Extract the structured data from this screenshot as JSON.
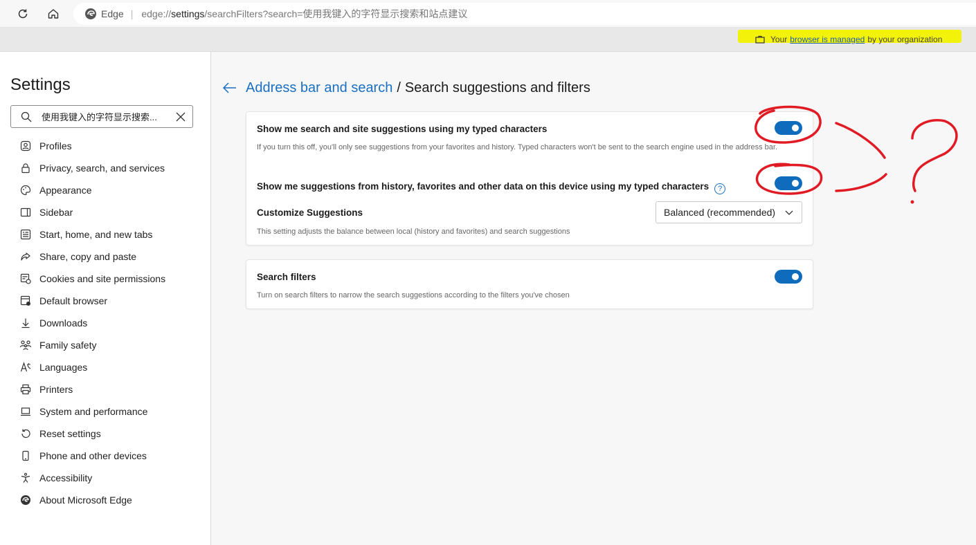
{
  "browser": {
    "brand": "Edge",
    "separator": "|",
    "url_scheme": "edge://",
    "url_host": "settings",
    "url_rest": "/searchFilters?search=使用我键入的字符显示搜索和站点建议",
    "icons": {
      "refresh": "refresh-icon",
      "home": "home-icon",
      "edge": "edge-logo-icon"
    }
  },
  "managed": {
    "prefix": "Your",
    "link": "browser is managed",
    "suffix": "by your organization",
    "highlight_color": "#f2f20a"
  },
  "sidebar": {
    "title": "Settings",
    "search_value": "使用我键入的字符显示搜索...",
    "items": [
      {
        "label": "Profiles",
        "icon": "profile-icon"
      },
      {
        "label": "Privacy, search, and services",
        "icon": "lock-icon"
      },
      {
        "label": "Appearance",
        "icon": "palette-icon"
      },
      {
        "label": "Sidebar",
        "icon": "sidebar-icon"
      },
      {
        "label": "Start, home, and new tabs",
        "icon": "home-tabs-icon"
      },
      {
        "label": "Share, copy and paste",
        "icon": "share-icon"
      },
      {
        "label": "Cookies and site permissions",
        "icon": "cookies-icon"
      },
      {
        "label": "Default browser",
        "icon": "default-browser-icon"
      },
      {
        "label": "Downloads",
        "icon": "download-icon"
      },
      {
        "label": "Family safety",
        "icon": "family-icon"
      },
      {
        "label": "Languages",
        "icon": "languages-icon"
      },
      {
        "label": "Printers",
        "icon": "printer-icon"
      },
      {
        "label": "System and performance",
        "icon": "system-icon"
      },
      {
        "label": "Reset settings",
        "icon": "reset-icon"
      },
      {
        "label": "Phone and other devices",
        "icon": "phone-icon"
      },
      {
        "label": "Accessibility",
        "icon": "accessibility-icon"
      },
      {
        "label": "About Microsoft Edge",
        "icon": "edge-icon"
      }
    ]
  },
  "breadcrumb": {
    "parent": "Address bar and search",
    "separator": "/",
    "current": "Search suggestions and filters"
  },
  "settings": {
    "suggestions": {
      "title": "Show me search and site suggestions using my typed characters",
      "desc": "If you turn this off, you'll only see suggestions from your favorites and history. Typed characters won't be sent to the search engine used in the address bar.",
      "enabled": true
    },
    "history": {
      "title": "Show me suggestions from history, favorites and other data on this device using my typed characters",
      "help_glyph": "?",
      "enabled": true
    },
    "customize": {
      "title": "Customize Suggestions",
      "desc": "This setting adjusts the balance between local (history and favorites) and search suggestions",
      "selected": "Balanced (recommended)"
    },
    "filters": {
      "title": "Search filters",
      "desc": "Turn on search filters to narrow the search suggestions according to the filters you've chosen",
      "enabled": true
    }
  },
  "colors": {
    "accent": "#0f6cbd",
    "link": "#1a6fc2",
    "annotation": "#e01b24"
  }
}
